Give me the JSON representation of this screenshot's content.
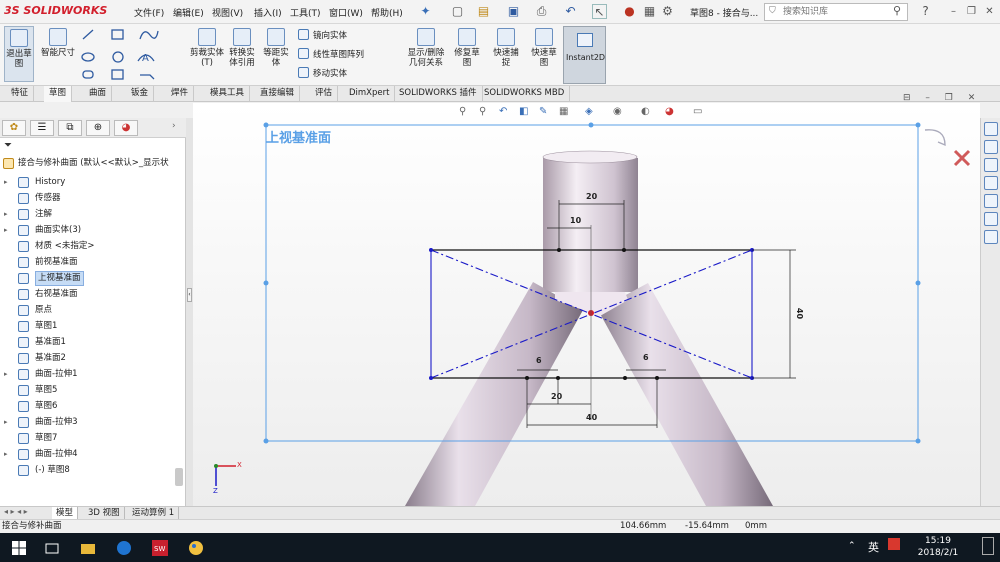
{
  "app": {
    "logo_prefix": "3S",
    "logo_text": "SOLIDWORKS"
  },
  "menu": [
    "文件(F)",
    "编辑(E)",
    "视图(V)",
    "插入(I)",
    "工具(T)",
    "窗口(W)",
    "帮助(H)"
  ],
  "title_bar": {
    "doc_title": "草图8 - 接合与...",
    "search_placeholder": "搜索知识库",
    "help": "?"
  },
  "ribbon": {
    "exit_sketch": "退出草图",
    "smart_dim": "智能尺寸",
    "trim": "剪裁实体(T)",
    "convert": "转换实体引用",
    "offset": "等距实体",
    "mirror": "镜向实体",
    "linear_pattern": "线性草图阵列",
    "move": "移动实体",
    "display_relations": "显示/删除几何关系",
    "repair": "修复草图",
    "quick_snaps": "快速捕捉",
    "rapid_sketch": "快速草图",
    "instant2d": "Instant2D"
  },
  "tabs": [
    "特征",
    "草图",
    "曲面",
    "钣金",
    "焊件",
    "模具工具",
    "直接编辑",
    "评估",
    "DimXpert",
    "SOLIDWORKS 插件",
    "SOLIDWORKS MBD"
  ],
  "active_tab": "草图",
  "feature_tree": {
    "root": "接合与修补曲面 (默认<<默认>_显示状",
    "items": [
      {
        "label": "History",
        "expand": "▸"
      },
      {
        "label": "传感器",
        "expand": ""
      },
      {
        "label": "注解",
        "expand": "▸"
      },
      {
        "label": "曲面实体(3)",
        "expand": "▸"
      },
      {
        "label": "材质 <未指定>",
        "expand": ""
      },
      {
        "label": "前视基准面",
        "expand": ""
      },
      {
        "label": "上视基准面",
        "expand": "",
        "selected": true
      },
      {
        "label": "右视基准面",
        "expand": ""
      },
      {
        "label": "原点",
        "expand": ""
      },
      {
        "label": "草图1",
        "expand": ""
      },
      {
        "label": "基准面1",
        "expand": ""
      },
      {
        "label": "基准面2",
        "expand": ""
      },
      {
        "label": "曲面-拉伸1",
        "expand": "▸"
      },
      {
        "label": "草图5",
        "expand": ""
      },
      {
        "label": "草图6",
        "expand": ""
      },
      {
        "label": "曲面-拉伸3",
        "expand": "▸"
      },
      {
        "label": "草图7",
        "expand": ""
      },
      {
        "label": "曲面-拉伸4",
        "expand": "▸"
      },
      {
        "label": "(-) 草图8",
        "expand": ""
      }
    ]
  },
  "viewport": {
    "plane_label": "上视基准面",
    "dims": {
      "top_20": "20",
      "top_10": "10",
      "left_6": "6",
      "right_6": "6",
      "bottom_20": "20",
      "bottom_40": "40",
      "height_40": "40"
    },
    "triad": {
      "x": "X",
      "z": "Z"
    }
  },
  "bottom_tabs": [
    "模型",
    "3D 视图",
    "运动算例 1"
  ],
  "status": {
    "doc": "接合与修补曲面",
    "x": "104.66mm",
    "y": "-15.64mm",
    "z": "0mm"
  },
  "taskbar": {
    "ime": "英",
    "time": "15:19",
    "date": "2018/2/1"
  },
  "colors": {
    "sketch_blue": "#1a1ac8",
    "plane_border": "#5aa0e6",
    "accent_red": "#d21f2c"
  }
}
